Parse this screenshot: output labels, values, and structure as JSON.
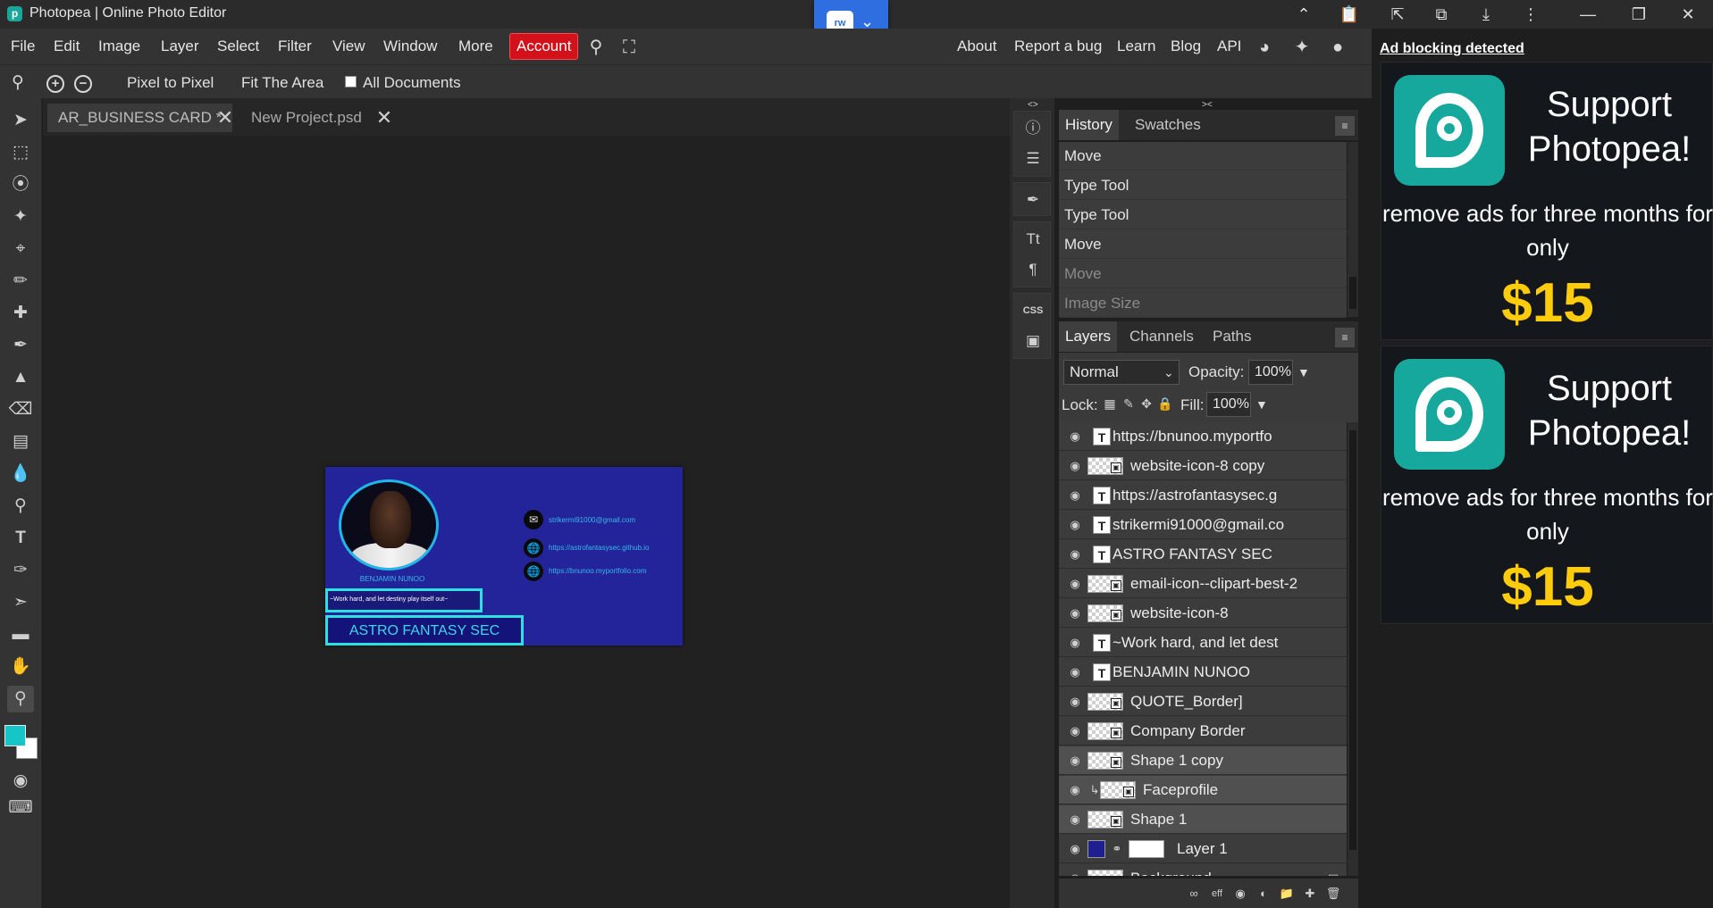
{
  "window": {
    "title": "Photopea | Online Photo Editor",
    "app_icon": "photopea-logo-icon",
    "extension_badge_label": "rw",
    "title_icons": [
      "chevron-up-icon",
      "clipboard-icon",
      "file-export-icon",
      "extension-icon",
      "download-icon",
      "more-vert-icon",
      "minimize-icon",
      "restore-icon",
      "close-icon"
    ]
  },
  "menu": {
    "items": [
      "File",
      "Edit",
      "Image",
      "Layer",
      "Select",
      "Filter",
      "View",
      "Window",
      "More"
    ],
    "account": "Account",
    "right_links": [
      "About",
      "Report a bug",
      "Learn",
      "Blog",
      "API"
    ],
    "social_icons": [
      "reddit-icon",
      "twitter-icon",
      "facebook-icon"
    ],
    "accent_color": "#d3111a"
  },
  "options": {
    "pixel_to_pixel": "Pixel to Pixel",
    "fit_area": "Fit The Area",
    "all_documents": "All Documents",
    "all_documents_checked": false
  },
  "tools": {
    "items": [
      "move-tool-icon",
      "marquee-tool-icon",
      "lasso-tool-icon",
      "magic-wand-icon",
      "crop-tool-icon",
      "eyedropper-icon",
      "healing-brush-icon",
      "brush-tool-icon",
      "stamp-tool-icon",
      "eraser-tool-icon",
      "gradient-tool-icon",
      "blur-tool-icon",
      "dodge-tool-icon",
      "type-tool-icon",
      "pen-tool-icon",
      "path-select-icon",
      "shape-tool-icon",
      "hand-tool-icon",
      "zoom-tool-icon"
    ],
    "active": "zoom-tool-icon",
    "foreground_color": "#16c6c6",
    "background_color": "#ffffff"
  },
  "documents": {
    "tabs": [
      {
        "label": "AR_BUSINESS CARD  *",
        "active": true
      },
      {
        "label": "New Project.psd",
        "active": false
      }
    ]
  },
  "card": {
    "name": "BENJAMIN NUNOO",
    "quote": "~Work hard, and let destiny play itself out~",
    "company": "ASTRO FANTASY SEC",
    "email": "strikermi91000@gmail.com",
    "website1": "https://astrofantasysec.github.io",
    "website2": "https://bnunoo.myportfolio.com",
    "background_color": "#24249a",
    "accent_color": "#2fe0e0"
  },
  "panels": {
    "history": {
      "tabs": [
        "History",
        "Swatches"
      ],
      "rows": [
        {
          "label": "Move",
          "future": false
        },
        {
          "label": "Type Tool",
          "future": false
        },
        {
          "label": "Type Tool",
          "future": false
        },
        {
          "label": "Move",
          "future": false
        },
        {
          "label": "Move",
          "future": true
        },
        {
          "label": "Image Size",
          "future": true
        }
      ]
    },
    "layers": {
      "tabs": [
        "Layers",
        "Channels",
        "Paths"
      ],
      "blend_mode": "Normal",
      "opacity_label": "Opacity:",
      "opacity": "100%",
      "lock_label": "Lock:",
      "fill_label": "Fill:",
      "fill": "100%",
      "rows": [
        {
          "name": "https://bnunoo.myportfo",
          "kind": "text",
          "selected": false
        },
        {
          "name": "website-icon-8 copy",
          "kind": "smart",
          "selected": false
        },
        {
          "name": "https://astrofantasysec.g",
          "kind": "text",
          "selected": false
        },
        {
          "name": "strikermi91000@gmail.co",
          "kind": "text",
          "selected": false
        },
        {
          "name": "ASTRO FANTASY SEC",
          "kind": "text",
          "selected": false
        },
        {
          "name": "email-icon--clipart-best-2",
          "kind": "smart",
          "selected": false
        },
        {
          "name": "website-icon-8",
          "kind": "smart",
          "selected": false
        },
        {
          "name": "~Work hard, and let dest",
          "kind": "text",
          "selected": false
        },
        {
          "name": "BENJAMIN NUNOO",
          "kind": "text",
          "selected": false
        },
        {
          "name": "QUOTE_Border]",
          "kind": "smart",
          "selected": false
        },
        {
          "name": "Company Border",
          "kind": "smart",
          "selected": false
        },
        {
          "name": "Shape 1 copy",
          "kind": "smart",
          "selected": true
        },
        {
          "name": "Faceprofile",
          "kind": "clipped",
          "selected": true
        },
        {
          "name": "Shape 1",
          "kind": "shape",
          "selected": true
        },
        {
          "name": "Layer 1",
          "kind": "masked",
          "selected": false
        },
        {
          "name": "Background",
          "kind": "background",
          "selected": false
        }
      ],
      "footer_icons": [
        "link-layers-icon",
        "effects-icon",
        "mask-icon",
        "adjustment-icon",
        "folder-icon",
        "new-layer-icon",
        "trash-icon"
      ]
    }
  },
  "ad": {
    "notice": "Ad blocking detected",
    "headline": "Support Photopea!",
    "subline": "remove ads for three months for only",
    "price": "$15",
    "price_color": "#ffcc0c",
    "logo_color": "#16a89c"
  }
}
